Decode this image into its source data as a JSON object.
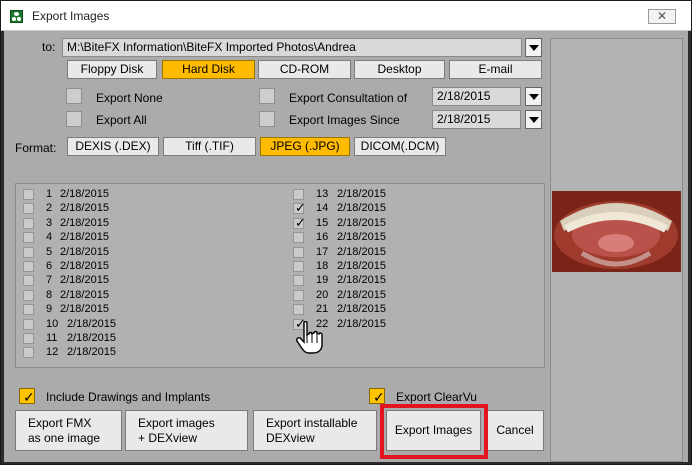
{
  "window": {
    "title": "Export Images",
    "close_label": "✕"
  },
  "to": {
    "label": "to:",
    "path": "M:\\BiteFX Information\\BiteFX Imported Photos\\Andrea"
  },
  "destinations": [
    {
      "label": "Floppy Disk",
      "active": false
    },
    {
      "label": "Hard Disk",
      "active": true
    },
    {
      "label": "CD-ROM",
      "active": false
    },
    {
      "label": "Desktop",
      "active": false
    },
    {
      "label": "E-mail",
      "active": false
    }
  ],
  "options": {
    "export_none": "Export None",
    "export_all": "Export All",
    "export_consultation": "Export Consultation of",
    "export_since": "Export Images Since",
    "consultation_date": "2/18/2015",
    "since_date": "2/18/2015"
  },
  "format": {
    "label": "Format:",
    "items": [
      {
        "label": "DEXIS (.DEX)",
        "active": false
      },
      {
        "label": "Tiff (.TIF)",
        "active": false
      },
      {
        "label": "JPEG (.JPG)",
        "active": true
      },
      {
        "label": "DICOM(.DCM)",
        "active": false
      }
    ]
  },
  "images_left": [
    {
      "num": "1",
      "date": "2/18/2015",
      "checked": false
    },
    {
      "num": "2",
      "date": "2/18/2015",
      "checked": false
    },
    {
      "num": "3",
      "date": "2/18/2015",
      "checked": false
    },
    {
      "num": "4",
      "date": "2/18/2015",
      "checked": false
    },
    {
      "num": "5",
      "date": "2/18/2015",
      "checked": false
    },
    {
      "num": "6",
      "date": "2/18/2015",
      "checked": false
    },
    {
      "num": "7",
      "date": "2/18/2015",
      "checked": false
    },
    {
      "num": "8",
      "date": "2/18/2015",
      "checked": false
    },
    {
      "num": "9",
      "date": "2/18/2015",
      "checked": false
    },
    {
      "num": "10",
      "date": "2/18/2015",
      "checked": false
    },
    {
      "num": "11",
      "date": "2/18/2015",
      "checked": false
    },
    {
      "num": "12",
      "date": "2/18/2015",
      "checked": false
    }
  ],
  "images_right": [
    {
      "num": "13",
      "date": "2/18/2015",
      "checked": false
    },
    {
      "num": "14",
      "date": "2/18/2015",
      "checked": true
    },
    {
      "num": "15",
      "date": "2/18/2015",
      "checked": true
    },
    {
      "num": "16",
      "date": "2/18/2015",
      "checked": false
    },
    {
      "num": "17",
      "date": "2/18/2015",
      "checked": false
    },
    {
      "num": "18",
      "date": "2/18/2015",
      "checked": false
    },
    {
      "num": "19",
      "date": "2/18/2015",
      "checked": false
    },
    {
      "num": "20",
      "date": "2/18/2015",
      "checked": false
    },
    {
      "num": "21",
      "date": "2/18/2015",
      "checked": false
    },
    {
      "num": "22",
      "date": "2/18/2015",
      "checked": true
    }
  ],
  "extras": {
    "include_drawings": "Include Drawings and Implants",
    "export_clearvu": "Export ClearVu",
    "check_mark": "✓"
  },
  "buttons": {
    "fmx_line1": "Export FMX",
    "fmx_line2": "as one image",
    "dexview_line1": "Export images",
    "dexview_line2": "+ DEXview",
    "installable_line1": "Export installable",
    "installable_line2": "DEXview",
    "export_images": "Export Images",
    "cancel": "Cancel"
  },
  "icons": {
    "app": "bitefx-app-icon",
    "close": "close-icon",
    "dropdown": "chevron-down-icon",
    "cursor": "hand-pointer-icon"
  },
  "colors": {
    "active": "#ffbb00",
    "highlight": "#e1141f"
  }
}
